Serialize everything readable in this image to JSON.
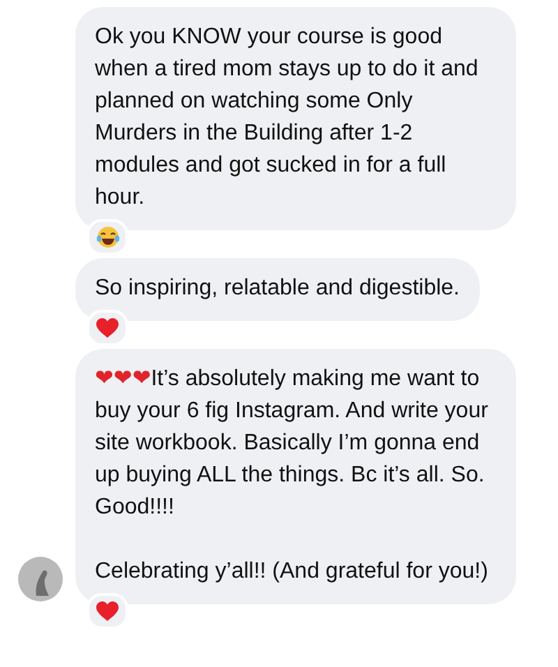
{
  "messages": [
    {
      "paragraphs": [
        {
          "text": "Ok you KNOW your course is good when a tired mom stays up to do it and planned on watching some Only Murders in the Building after 1-2 modules and got sucked in for a full hour."
        }
      ],
      "reaction": {
        "kind": "laugh"
      },
      "avatar": false
    },
    {
      "paragraphs": [
        {
          "text": "So inspiring, relatable and digestible."
        }
      ],
      "reaction": {
        "kind": "heart"
      },
      "avatar": false
    },
    {
      "paragraphs": [
        {
          "emoji": "❤❤❤",
          "text": "It’s absolutely making me want to buy your 6 fig Instagram. And write your site workbook. Basically I’m gonna end up buying ALL the things. Bc it’s all. So. Good!!!!"
        },
        {
          "text": "Celebrating y’all!! (And grateful for you!)"
        }
      ],
      "reaction": {
        "kind": "heart"
      },
      "avatar": true
    }
  ]
}
